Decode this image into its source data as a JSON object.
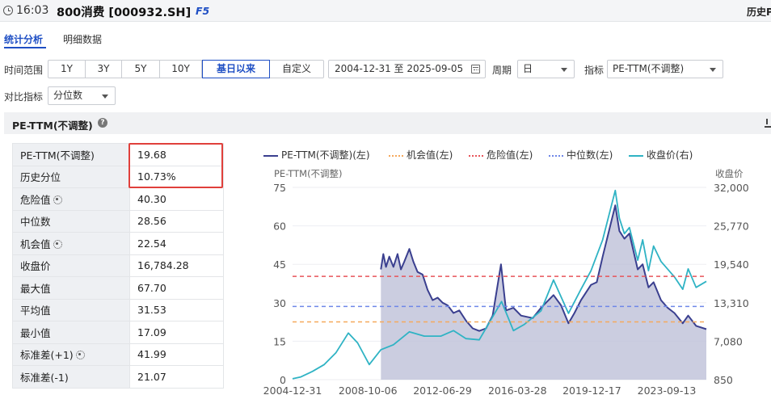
{
  "titlebar": {
    "time": "16:03",
    "title": "800消费 [000932.SH]",
    "shortcut": "F5",
    "right_label": "历史PE"
  },
  "tabs": [
    {
      "label": "统计分析",
      "active": true
    },
    {
      "label": "明细数据",
      "active": false
    }
  ],
  "controls": {
    "time_range_label": "时间范围",
    "ranges": [
      "1Y",
      "3Y",
      "5Y",
      "10Y",
      "基日以来",
      "自定义"
    ],
    "active_range": "基日以来",
    "date_range": "2004-12-31 至 2025-09-05",
    "period_label": "周期",
    "period_value": "日",
    "indicator_label": "指标",
    "indicator_value": "PE-TTM(不调整)",
    "compare_label": "对比指标",
    "compare_value": "分位数"
  },
  "section": {
    "title": "PE-TTM(不调整)",
    "help": "?"
  },
  "stats": [
    {
      "label": "PE-TTM(不调整)",
      "value": "19.68",
      "gear": false
    },
    {
      "label": "历史分位",
      "value": "10.73%",
      "gear": false
    },
    {
      "label": "危险值",
      "value": "40.30",
      "gear": true
    },
    {
      "label": "中位数",
      "value": "28.56",
      "gear": false
    },
    {
      "label": "机会值",
      "value": "22.54",
      "gear": true
    },
    {
      "label": "收盘价",
      "value": "16,784.28",
      "gear": false
    },
    {
      "label": "最大值",
      "value": "67.70",
      "gear": false
    },
    {
      "label": "平均值",
      "value": "31.53",
      "gear": false
    },
    {
      "label": "最小值",
      "value": "17.09",
      "gear": false
    },
    {
      "label": "标准差(+1)",
      "value": "41.99",
      "gear": true
    },
    {
      "label": "标准差(-1)",
      "value": "21.07",
      "gear": false
    }
  ],
  "colors": {
    "accent": "#1f4fc4",
    "pe_line": "#3a3f8f",
    "pe_fill": "#b9bcd6",
    "close_line": "#2fb3c4",
    "danger": "#e8545a",
    "median": "#6f87e8",
    "opportunity": "#f5a95c",
    "highlight": "#e0403b"
  },
  "chart_data": {
    "type": "line",
    "legend": [
      "PE-TTM(不调整)(左)",
      "机会值(左)",
      "危险值(左)",
      "中位数(左)",
      "收盘价(右)"
    ],
    "left_axis_title": "PE-TTM(不调整)",
    "right_axis_title": "收盘价",
    "left_ticks": [
      "0",
      "15",
      "30",
      "45",
      "60",
      "75"
    ],
    "right_ticks": [
      "850",
      "7,080",
      "13,310",
      "19,540",
      "25,770",
      "32,000"
    ],
    "x_ticks": [
      "2004-12-31",
      "2008-10-06",
      "2012-06-29",
      "2016-03-28",
      "2019-12-17",
      "2023-09-13"
    ],
    "ylim_left": [
      0,
      75
    ],
    "ylim_right": [
      850,
      32000
    ],
    "reference_lines": {
      "danger": 40.3,
      "median": 28.56,
      "opportunity": 22.54
    },
    "pe_series": [
      [
        "2009-06-01",
        43
      ],
      [
        "2009-07-15",
        49
      ],
      [
        "2009-09-01",
        44
      ],
      [
        "2009-11-01",
        48
      ],
      [
        "2010-01-15",
        44
      ],
      [
        "2010-04-01",
        49
      ],
      [
        "2010-06-01",
        43
      ],
      [
        "2010-08-01",
        46
      ],
      [
        "2010-11-01",
        51
      ],
      [
        "2011-01-15",
        46
      ],
      [
        "2011-04-01",
        42
      ],
      [
        "2011-07-01",
        41
      ],
      [
        "2011-10-01",
        35
      ],
      [
        "2012-01-01",
        31
      ],
      [
        "2012-04-01",
        32
      ],
      [
        "2012-07-01",
        30
      ],
      [
        "2012-10-01",
        29
      ],
      [
        "2013-01-15",
        26
      ],
      [
        "2013-05-01",
        27
      ],
      [
        "2013-09-01",
        23
      ],
      [
        "2014-01-01",
        20
      ],
      [
        "2014-05-01",
        19
      ],
      [
        "2014-09-01",
        20
      ],
      [
        "2015-01-01",
        25
      ],
      [
        "2015-06-01",
        45
      ],
      [
        "2015-09-01",
        27
      ],
      [
        "2016-01-15",
        28
      ],
      [
        "2016-06-01",
        25
      ],
      [
        "2017-01-01",
        24
      ],
      [
        "2017-06-01",
        28
      ],
      [
        "2018-01-15",
        33
      ],
      [
        "2018-06-01",
        29
      ],
      [
        "2018-10-15",
        22
      ],
      [
        "2019-02-01",
        26
      ],
      [
        "2019-06-01",
        31
      ],
      [
        "2019-12-01",
        37
      ],
      [
        "2020-03-15",
        38
      ],
      [
        "2020-07-01",
        48
      ],
      [
        "2021-02-15",
        68
      ],
      [
        "2021-05-01",
        58
      ],
      [
        "2021-08-01",
        55
      ],
      [
        "2021-11-01",
        57
      ],
      [
        "2022-04-01",
        43
      ],
      [
        "2022-07-01",
        45
      ],
      [
        "2022-10-15",
        36
      ],
      [
        "2023-01-15",
        38
      ],
      [
        "2023-06-01",
        31
      ],
      [
        "2023-10-01",
        28
      ],
      [
        "2024-02-01",
        26
      ],
      [
        "2024-07-01",
        22
      ],
      [
        "2024-10-08",
        25
      ],
      [
        "2025-03-01",
        21
      ],
      [
        "2025-09-05",
        19.68
      ]
    ],
    "close_series": [
      [
        "2004-12-31",
        1000
      ],
      [
        "2005-06-01",
        1300
      ],
      [
        "2006-01-01",
        2200
      ],
      [
        "2006-08-01",
        3300
      ],
      [
        "2007-03-01",
        5200
      ],
      [
        "2007-10-15",
        8400
      ],
      [
        "2008-04-01",
        6800
      ],
      [
        "2008-10-31",
        3300
      ],
      [
        "2009-06-01",
        5700
      ],
      [
        "2010-01-15",
        6500
      ],
      [
        "2010-11-01",
        8600
      ],
      [
        "2011-08-01",
        7900
      ],
      [
        "2012-06-01",
        7900
      ],
      [
        "2013-01-15",
        8800
      ],
      [
        "2013-09-01",
        7500
      ],
      [
        "2014-05-01",
        7300
      ],
      [
        "2015-06-12",
        13500
      ],
      [
        "2016-01-15",
        8800
      ],
      [
        "2016-08-01",
        9800
      ],
      [
        "2017-06-01",
        12000
      ],
      [
        "2018-01-15",
        17000
      ],
      [
        "2018-10-15",
        11600
      ],
      [
        "2019-06-01",
        15500
      ],
      [
        "2019-12-01",
        18500
      ],
      [
        "2020-07-01",
        23500
      ],
      [
        "2021-02-15",
        31500
      ],
      [
        "2021-05-01",
        27000
      ],
      [
        "2021-08-01",
        24500
      ],
      [
        "2021-11-01",
        25500
      ],
      [
        "2022-04-01",
        20200
      ],
      [
        "2022-07-01",
        23500
      ],
      [
        "2022-10-15",
        18500
      ],
      [
        "2023-01-15",
        22500
      ],
      [
        "2023-06-01",
        20000
      ],
      [
        "2024-02-01",
        17500
      ],
      [
        "2024-07-01",
        15500
      ],
      [
        "2024-10-08",
        18800
      ],
      [
        "2025-03-01",
        15800
      ],
      [
        "2025-09-05",
        16784.28
      ]
    ]
  }
}
